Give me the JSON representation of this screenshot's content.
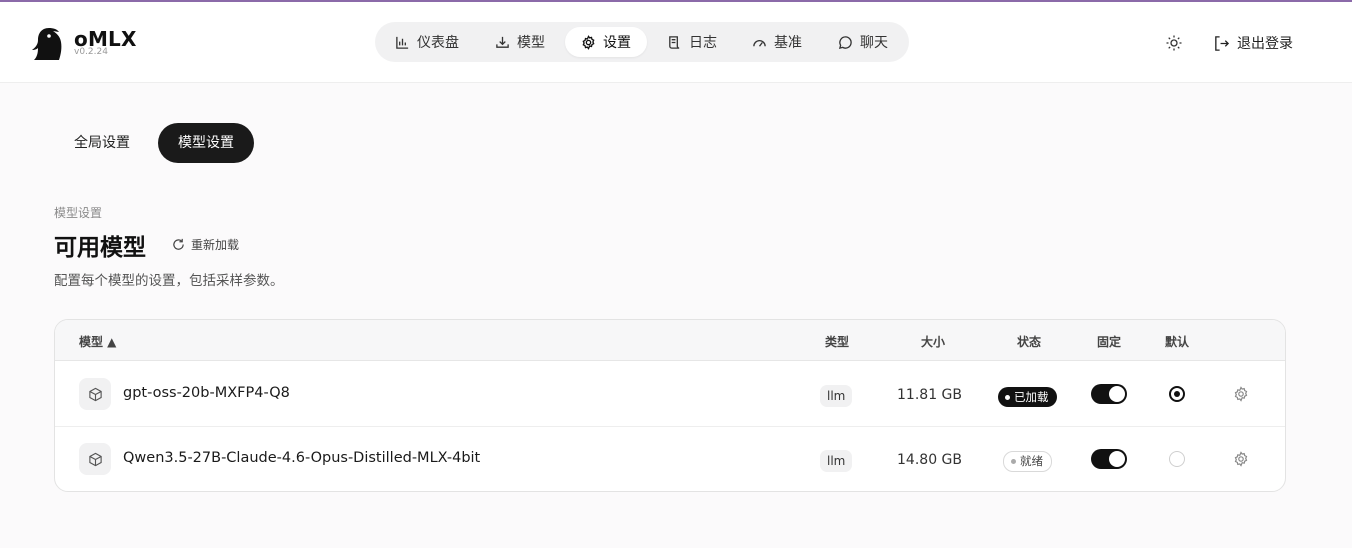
{
  "app": {
    "name": "oMLX",
    "version": "v0.2.24"
  },
  "nav": [
    {
      "label": "仪表盘",
      "icon": "bar-chart-icon",
      "active": false
    },
    {
      "label": "模型",
      "icon": "download-icon",
      "active": false
    },
    {
      "label": "设置",
      "icon": "gear-icon",
      "active": true
    },
    {
      "label": "日志",
      "icon": "scroll-icon",
      "active": false
    },
    {
      "label": "基准",
      "icon": "gauge-icon",
      "active": false
    },
    {
      "label": "聊天",
      "icon": "chat-bubble-icon",
      "active": false
    }
  ],
  "header": {
    "logout_label": "退出登录",
    "theme_icon": "sun-icon",
    "logout_icon": "logout-icon"
  },
  "tabs": {
    "global": "全局设置",
    "model": "模型设置",
    "active": "model"
  },
  "page": {
    "breadcrumb": "模型设置",
    "title": "可用模型",
    "reload_label": "重新加载",
    "description": "配置每个模型的设置，包括采样参数。"
  },
  "table": {
    "headers": {
      "model": "模型 ▲",
      "type": "类型",
      "size": "大小",
      "status": "状态",
      "pinned": "固定",
      "default": "默认"
    },
    "rows": [
      {
        "name": "gpt-oss-20b-MXFP4-Q8",
        "type": "llm",
        "size": "11.81 GB",
        "status": "已加载",
        "status_kind": "loaded",
        "pinned": true,
        "default": true
      },
      {
        "name": "Qwen3.5-27B-Claude-4.6-Opus-Distilled-MLX-4bit",
        "type": "llm",
        "size": "14.80 GB",
        "status": "就绪",
        "status_kind": "ready",
        "pinned": true,
        "default": false
      }
    ]
  },
  "colors": {
    "accent_line": "#8b6aa9",
    "dark": "#111111",
    "background": "#fbfafb"
  }
}
